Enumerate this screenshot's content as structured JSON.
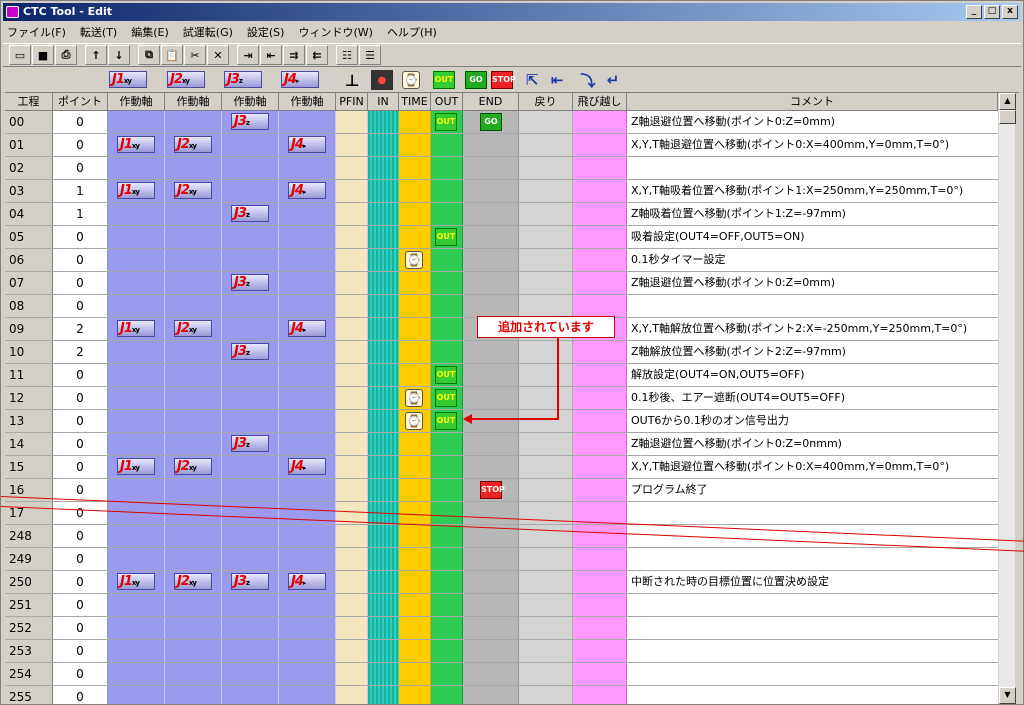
{
  "window": {
    "title": "CTC Tool - Edit",
    "minimize": "_",
    "restore": "□",
    "close": "x"
  },
  "menu": [
    "ファイル(F)",
    "転送(T)",
    "編集(E)",
    "試運転(G)",
    "設定(S)",
    "ウィンドウ(W)",
    "ヘルプ(H)"
  ],
  "toolbar": [
    {
      "name": "open-icon",
      "glyph": "▭"
    },
    {
      "name": "save-icon",
      "glyph": "■"
    },
    {
      "name": "print-icon",
      "glyph": "⎙"
    },
    {
      "name": "up-arrow-icon",
      "glyph": "↑"
    },
    {
      "name": "down-arrow-icon",
      "glyph": "↓"
    },
    {
      "name": "copy-icon",
      "glyph": "⧉"
    },
    {
      "name": "paste-icon",
      "glyph": "📋"
    },
    {
      "name": "cut-icon",
      "glyph": "✂"
    },
    {
      "name": "delete-icon",
      "glyph": "✕"
    },
    {
      "name": "insert-col-icon",
      "glyph": "⇥"
    },
    {
      "name": "insert-row-icon",
      "glyph": "⇤"
    },
    {
      "name": "shift-right-icon",
      "glyph": "⇉"
    },
    {
      "name": "shift-left-icon",
      "glyph": "⇇"
    },
    {
      "name": "signal-icon",
      "glyph": "☷"
    },
    {
      "name": "signal2-icon",
      "glyph": "☰"
    }
  ],
  "iconbar": {
    "j1": "J1",
    "j2": "J2",
    "j3": "J3",
    "j4": "J4",
    "out": "OUT",
    "go": "GO",
    "stop": "STOP"
  },
  "columns": [
    "工程",
    "ポイント",
    "作動軸",
    "作動軸",
    "作動軸",
    "作動軸",
    "PFIN",
    "IN",
    "TIME",
    "OUT",
    "END",
    "戻り",
    "飛び越し",
    "コメント"
  ],
  "rows": [
    {
      "step": "00",
      "point": "0",
      "j1": false,
      "j2": false,
      "j3": true,
      "j4": false,
      "time": false,
      "out": true,
      "end": "go",
      "comment": "Z軸退避位置へ移動(ポイント0:Z=0mm)"
    },
    {
      "step": "01",
      "point": "0",
      "j1": true,
      "j2": true,
      "j3": false,
      "j4": true,
      "time": false,
      "out": false,
      "end": "",
      "comment": "X,Y,T軸退避位置へ移動(ポイント0:X=400mm,Y=0mm,T=0°)"
    },
    {
      "step": "02",
      "point": "0",
      "j1": false,
      "j2": false,
      "j3": false,
      "j4": false,
      "time": false,
      "out": false,
      "end": "",
      "comment": ""
    },
    {
      "step": "03",
      "point": "1",
      "j1": true,
      "j2": true,
      "j3": false,
      "j4": true,
      "time": false,
      "out": false,
      "end": "",
      "comment": "X,Y,T軸吸着位置へ移動(ポイント1:X=250mm,Y=250mm,T=0°)"
    },
    {
      "step": "04",
      "point": "1",
      "j1": false,
      "j2": false,
      "j3": true,
      "j4": false,
      "time": false,
      "out": false,
      "end": "",
      "comment": "Z軸吸着位置へ移動(ポイント1:Z=-97mm)"
    },
    {
      "step": "05",
      "point": "0",
      "j1": false,
      "j2": false,
      "j3": false,
      "j4": false,
      "time": false,
      "out": true,
      "end": "",
      "comment": "吸着設定(OUT4=OFF,OUT5=ON)"
    },
    {
      "step": "06",
      "point": "0",
      "j1": false,
      "j2": false,
      "j3": false,
      "j4": false,
      "time": true,
      "out": false,
      "end": "",
      "comment": "0.1秒タイマー設定"
    },
    {
      "step": "07",
      "point": "0",
      "j1": false,
      "j2": false,
      "j3": true,
      "j4": false,
      "time": false,
      "out": false,
      "end": "",
      "comment": "Z軸退避位置へ移動(ポイント0:Z=0mm)"
    },
    {
      "step": "08",
      "point": "0",
      "j1": false,
      "j2": false,
      "j3": false,
      "j4": false,
      "time": false,
      "out": false,
      "end": "",
      "comment": ""
    },
    {
      "step": "09",
      "point": "2",
      "j1": true,
      "j2": true,
      "j3": false,
      "j4": true,
      "time": false,
      "out": false,
      "end": "",
      "comment": "X,Y,T軸解放位置へ移動(ポイント2:X=-250mm,Y=250mm,T=0°)"
    },
    {
      "step": "10",
      "point": "2",
      "j1": false,
      "j2": false,
      "j3": true,
      "j4": false,
      "time": false,
      "out": false,
      "end": "",
      "comment": "Z軸解放位置へ移動(ポイント2:Z=-97mm)"
    },
    {
      "step": "11",
      "point": "0",
      "j1": false,
      "j2": false,
      "j3": false,
      "j4": false,
      "time": false,
      "out": true,
      "end": "",
      "comment": "解放設定(OUT4=ON,OUT5=OFF)"
    },
    {
      "step": "12",
      "point": "0",
      "j1": false,
      "j2": false,
      "j3": false,
      "j4": false,
      "time": true,
      "out": true,
      "end": "",
      "comment": "0.1秒後、エアー遮断(OUT4=OUT5=OFF)"
    },
    {
      "step": "13",
      "point": "0",
      "j1": false,
      "j2": false,
      "j3": false,
      "j4": false,
      "time": true,
      "out": true,
      "end": "",
      "comment": "OUT6から0.1秒のオン信号出力"
    },
    {
      "step": "14",
      "point": "0",
      "j1": false,
      "j2": false,
      "j3": true,
      "j4": false,
      "time": false,
      "out": false,
      "end": "",
      "comment": "Z軸退避位置へ移動(ポイント0:Z=0nmm)"
    },
    {
      "step": "15",
      "point": "0",
      "j1": true,
      "j2": true,
      "j3": false,
      "j4": true,
      "time": false,
      "out": false,
      "end": "",
      "comment": "X,Y,T軸退避位置へ移動(ポイント0:X=400mm,Y=0mm,T=0°)"
    },
    {
      "step": "16",
      "point": "0",
      "j1": false,
      "j2": false,
      "j3": false,
      "j4": false,
      "time": false,
      "out": false,
      "end": "stop",
      "comment": "プログラム終了"
    },
    {
      "step": "17",
      "point": "0",
      "j1": false,
      "j2": false,
      "j3": false,
      "j4": false,
      "time": false,
      "out": false,
      "end": "",
      "comment": ""
    },
    {
      "step": "248",
      "point": "0",
      "j1": false,
      "j2": false,
      "j3": false,
      "j4": false,
      "time": false,
      "out": false,
      "end": "",
      "comment": ""
    },
    {
      "step": "249",
      "point": "0",
      "j1": false,
      "j2": false,
      "j3": false,
      "j4": false,
      "time": false,
      "out": false,
      "end": "",
      "comment": ""
    },
    {
      "step": "250",
      "point": "0",
      "j1": true,
      "j2": true,
      "j3": true,
      "j4": true,
      "time": false,
      "out": false,
      "end": "",
      "comment": "中断された時の目標位置に位置決め設定"
    },
    {
      "step": "251",
      "point": "0",
      "j1": false,
      "j2": false,
      "j3": false,
      "j4": false,
      "time": false,
      "out": false,
      "end": "",
      "comment": ""
    },
    {
      "step": "252",
      "point": "0",
      "j1": false,
      "j2": false,
      "j3": false,
      "j4": false,
      "time": false,
      "out": false,
      "end": "",
      "comment": ""
    },
    {
      "step": "253",
      "point": "0",
      "j1": false,
      "j2": false,
      "j3": false,
      "j4": false,
      "time": false,
      "out": false,
      "end": "",
      "comment": ""
    },
    {
      "step": "254",
      "point": "0",
      "j1": false,
      "j2": false,
      "j3": false,
      "j4": false,
      "time": false,
      "out": false,
      "end": "",
      "comment": ""
    },
    {
      "step": "255",
      "point": "0",
      "j1": false,
      "j2": false,
      "j3": false,
      "j4": false,
      "time": false,
      "out": false,
      "end": "",
      "comment": ""
    }
  ],
  "callout": "追加されています",
  "scroll": {
    "up": "▲",
    "down": "▼"
  }
}
